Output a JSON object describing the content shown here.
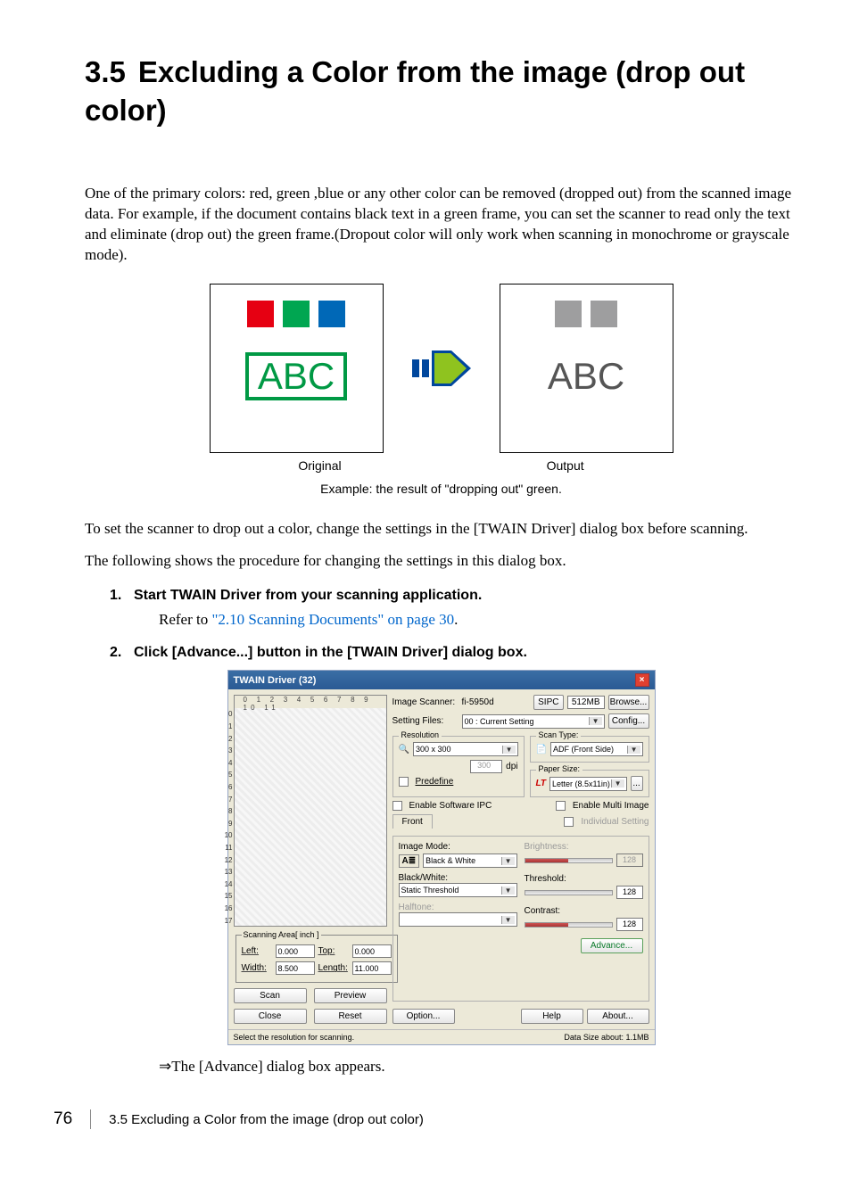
{
  "heading": {
    "num": "3.5",
    "title": "Excluding a Color from the image (drop out color)"
  },
  "intro": "One of the primary colors: red, green ,blue or any other color can be removed (dropped out) from the scanned image data. For example, if the document contains black text in a green frame, you can set the scanner to read only the text and eliminate (drop out) the green frame.(Dropout color will only work when scanning in monochrome or grayscale mode).",
  "example": {
    "abc": "ABC",
    "original": "Original",
    "output": "Output",
    "caption": "Example: the result of \"dropping out\" green."
  },
  "para2": "To set the scanner to drop out a color, change the settings in the [TWAIN Driver] dialog box before scanning.",
  "para3": "The following shows the procedure for changing the settings in this dialog box.",
  "steps": [
    {
      "num": "1.",
      "title": "Start TWAIN Driver from your scanning application.",
      "body_prefix": "Refer to ",
      "body_link": "\"2.10 Scanning Documents\" on page 30",
      "body_suffix": "."
    },
    {
      "num": "2.",
      "title": "Click [Advance...] button in the [TWAIN Driver] dialog box."
    }
  ],
  "twain": {
    "title": "TWAIN Driver (32)",
    "ruler_top": "0 1 2 3 4 5 6 7 8 9 10 11",
    "scanning_area_label": "Scanning Area[ inch ]",
    "left_label": "Left:",
    "top_label": "Top:",
    "width_label": "Width:",
    "length_label": "Length:",
    "left_val": "0.000",
    "top_val": "0.000",
    "width_val": "8.500",
    "length_val": "11.000",
    "scan_btn": "Scan",
    "preview_btn": "Preview",
    "close_btn": "Close",
    "reset_btn": "Reset",
    "image_scanner_label": "Image Scanner:",
    "image_scanner_value": "fi-5950d",
    "sipc": "SIPC",
    "mem": "512MB",
    "browse_btn": "Browse...",
    "setting_files_label": "Setting Files:",
    "setting_files_value": "00 : Current Setting",
    "config_btn": "Config...",
    "resolution_label": "Resolution",
    "resolution_value": "300 x 300",
    "resolution_num": "300",
    "dpi": "dpi",
    "predefine": "Predefine",
    "scan_type_label": "Scan Type:",
    "scan_type_value": "ADF (Front Side)",
    "paper_size_label": "Paper Size:",
    "paper_size_value": "Letter (8.5x11in)",
    "enable_sw_ipc": "Enable Software IPC",
    "enable_multi": "Enable Multi Image",
    "front_label": "Front",
    "individual": "Individual Setting",
    "image_mode_label": "Image Mode:",
    "image_mode_value": "Black & White",
    "bw_label": "Black/White:",
    "bw_value": "Static Threshold",
    "halftone_label": "Halftone:",
    "brightness_label": "Brightness:",
    "threshold_label": "Threshold:",
    "contrast_label": "Contrast:",
    "v128": "128",
    "advance_btn": "Advance...",
    "option_btn": "Option...",
    "help_btn": "Help",
    "about_btn": "About...",
    "status_left": "Select the resolution for scanning.",
    "status_right_label": "Data Size about:",
    "status_right_value": "1.1MB"
  },
  "result_arrow": "⇒",
  "result_text": "The [Advance] dialog box appears.",
  "footer": {
    "page": "76",
    "title": "3.5 Excluding a Color from the image (drop out color)"
  }
}
